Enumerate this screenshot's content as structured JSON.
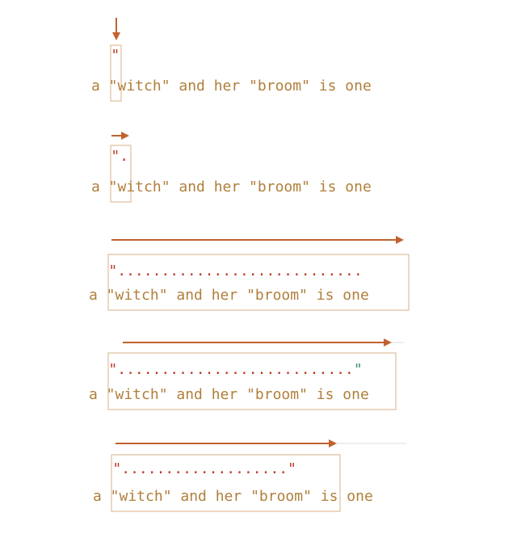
{
  "colors": {
    "text": "#b07f3b",
    "red": "#c0392b",
    "green": "#3f8f6b",
    "arrow": "#c0622f",
    "box": "#e2c3a3",
    "line": "#dedede"
  },
  "steps": [
    {
      "sentence": [
        "a",
        "\"witch\"",
        "and",
        "her",
        "\"broom\"",
        "is",
        "one"
      ],
      "pattern": "\"",
      "arrow_style": "down-arrow-icon"
    },
    {
      "sentence": [
        "a",
        "\"witch\"",
        "and",
        "her",
        "\"broom\"",
        "is",
        "one"
      ],
      "pattern": "\".",
      "arrow_style": "right-arrow-icon"
    },
    {
      "sentence": [
        "a",
        "\"witch\"",
        "and",
        "her",
        "\"broom\"",
        "is",
        "one"
      ],
      "pattern": "\"............................",
      "arrow_style": "right-arrow-icon"
    },
    {
      "sentence": [
        "a",
        "\"witch\"",
        "and",
        "her",
        "\"broom\"",
        "is",
        "one"
      ],
      "pattern": "\"...........................\"",
      "arrow_style": "right-arrow-icon"
    },
    {
      "sentence": [
        "a",
        "\"witch\"",
        "and",
        "her",
        "\"broom\"",
        "is",
        "one"
      ],
      "pattern": "\"...................\"",
      "arrow_style": "right-arrow-icon"
    }
  ]
}
